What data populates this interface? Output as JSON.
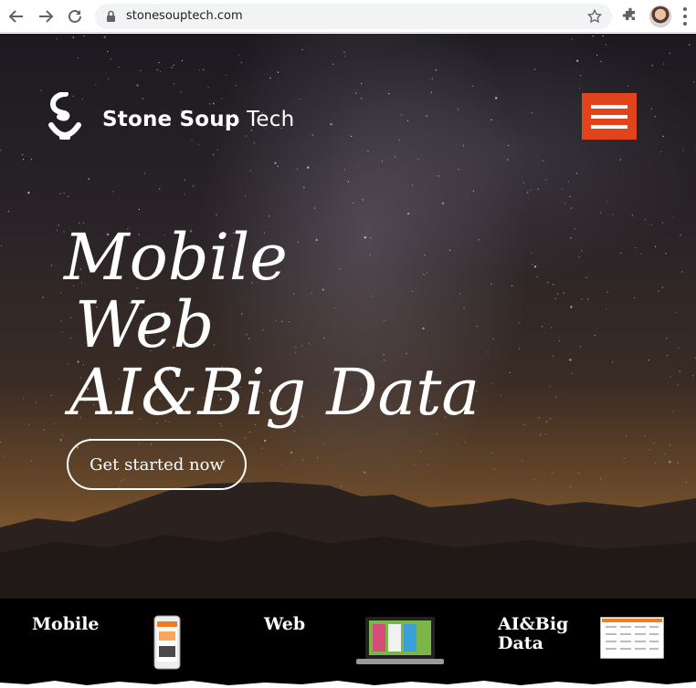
{
  "browser": {
    "url": "stonesouptech.com",
    "icons": [
      "back-arrow-icon",
      "forward-arrow-icon",
      "reload-icon",
      "lock-icon",
      "star-icon",
      "extensions-icon",
      "profile-avatar",
      "more-menu-icon"
    ]
  },
  "header": {
    "brand_bold": "Stone Soup",
    "brand_light": " Tech",
    "menu_icon": "hamburger-menu-icon",
    "menu_color": "#e1441c"
  },
  "hero": {
    "lines": [
      "Mobile",
      "Web",
      "AI&Big Data"
    ],
    "cta_label": "Get started now"
  },
  "services": [
    {
      "label": "Mobile",
      "thumb": "phone-screenshot"
    },
    {
      "label": "Web",
      "thumb": "laptop-screenshot"
    },
    {
      "label_line1": "AI&Big",
      "label_line2": "Data",
      "thumb": "dashboard-screenshot"
    }
  ]
}
